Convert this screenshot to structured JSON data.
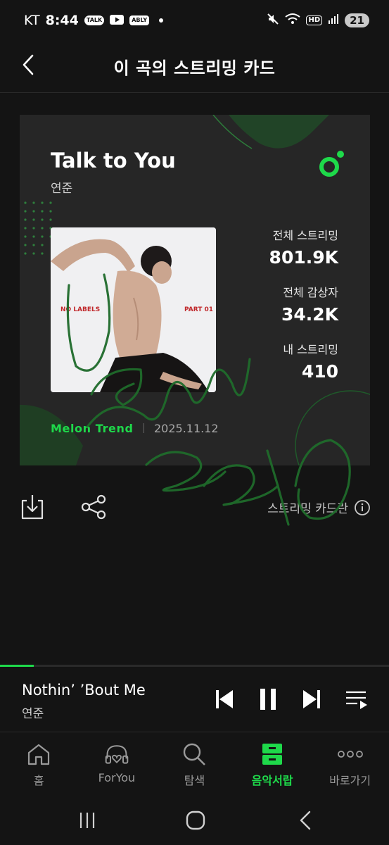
{
  "status_bar": {
    "carrier": "KT",
    "time": "8:44",
    "chips": [
      "TALK",
      "ABLY"
    ],
    "battery": "21",
    "network": "HD"
  },
  "header": {
    "title": "이 곡의 스트리밍 카드"
  },
  "card": {
    "song_title": "Talk to You",
    "artist": "연준",
    "album_art": {
      "left_text": "NO LABELS",
      "right_text": "PART 01"
    },
    "stats": [
      {
        "label": "전체 스트리밍",
        "value": "801.9K"
      },
      {
        "label": "전체 감상자",
        "value": "34.2K"
      },
      {
        "label": "내 스트리밍",
        "value": "410"
      }
    ],
    "trend_label": "Melon Trend",
    "date": "2025.11.12"
  },
  "actions": {
    "card_info_label": "스트리밍 카드란"
  },
  "player": {
    "progress": 0.087,
    "title": "Nothin’ ’Bout Me",
    "artist": "연준"
  },
  "bottom_nav": {
    "items": [
      {
        "label": "홈",
        "icon": "home-icon"
      },
      {
        "label": "ForYou",
        "icon": "foryou-headphones-icon"
      },
      {
        "label": "탐색",
        "icon": "search-icon"
      },
      {
        "label": "음악서랍",
        "icon": "music-drawer-icon"
      },
      {
        "label": "바로가기",
        "icon": "more-dots-icon"
      }
    ],
    "active_index": 3
  },
  "colors": {
    "accent": "#1ed94a",
    "background": "#141414",
    "card": "#262626",
    "handwriting": "#1f6b2b"
  }
}
